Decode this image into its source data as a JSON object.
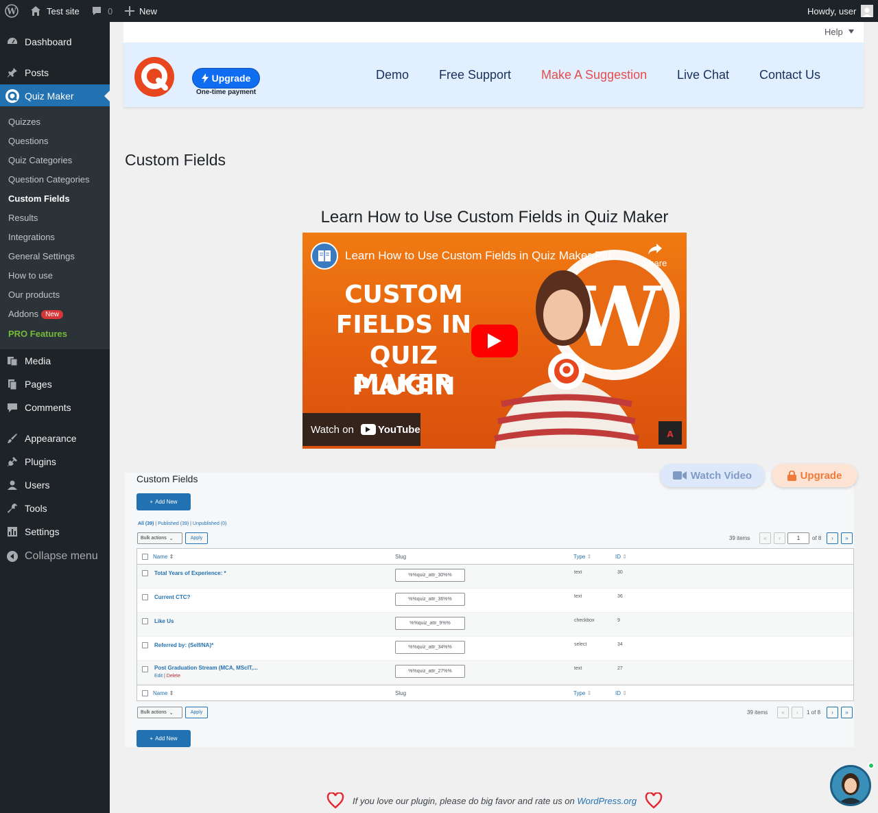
{
  "adminbar": {
    "site_name": "Test site",
    "comments_count": "0",
    "new_label": "New",
    "howdy": "Howdy, user"
  },
  "sidebar": {
    "items": [
      {
        "label": "Dashboard",
        "icon": "dashboard-icon"
      },
      {
        "label": "Posts",
        "icon": "pin-icon"
      },
      {
        "label": "Quiz Maker",
        "icon": "quiz-maker-icon"
      },
      {
        "label": "Media",
        "icon": "media-icon"
      },
      {
        "label": "Pages",
        "icon": "pages-icon"
      },
      {
        "label": "Comments",
        "icon": "comment-icon"
      },
      {
        "label": "Appearance",
        "icon": "brush-icon"
      },
      {
        "label": "Plugins",
        "icon": "plug-icon"
      },
      {
        "label": "Users",
        "icon": "user-icon"
      },
      {
        "label": "Tools",
        "icon": "wrench-icon"
      },
      {
        "label": "Settings",
        "icon": "settings-icon"
      },
      {
        "label": "Collapse menu",
        "icon": "collapse-icon"
      }
    ],
    "submenu": [
      "Quizzes",
      "Questions",
      "Quiz Categories",
      "Question Categories",
      "Custom Fields",
      "Results",
      "Integrations",
      "General Settings",
      "How to use",
      "Our products",
      "Addons",
      "PRO Features"
    ],
    "addons_badge": "New"
  },
  "help_tab": "Help",
  "header": {
    "upgrade_label": "Upgrade",
    "upgrade_note": "One-time payment",
    "nav": [
      "Demo",
      "Free Support",
      "Make A Suggestion",
      "Live Chat",
      "Contact Us"
    ]
  },
  "page_title": "Custom Fields",
  "video": {
    "heading": "Learn How to Use Custom Fields in Quiz Maker",
    "title": "Learn How to Use Custom Fields in Quiz Maker Plu...",
    "share": "Share",
    "big_lines": [
      "CUSTOM",
      "FIELDS IN",
      "QUIZ MAKER",
      "PLUGIN"
    ],
    "watch_on": "Watch on",
    "youtube": "YouTube"
  },
  "actions": {
    "watch_video": "Watch Video",
    "upgrade": "Upgrade"
  },
  "cf_screenshot": {
    "title": "Custom Fields",
    "add_new": "Add New",
    "filters": {
      "all": "All (39)",
      "published": "Published (39)",
      "unpublished": "Unpublished (0)"
    },
    "bulk_actions": "Bulk actions",
    "apply": "Apply",
    "items_count": "39 items",
    "page_current": "1",
    "page_of": "of 8",
    "page_text_bottom": "1 of 8",
    "columns": {
      "name": "Name",
      "slug": "Slug",
      "type": "Type",
      "id": "ID"
    },
    "rows": [
      {
        "name": "Total Years of Experience: *",
        "slug": "%%quiz_attr_30%%",
        "type": "text",
        "id": "30"
      },
      {
        "name": "Current CTC?",
        "slug": "%%quiz_attr_36%%",
        "type": "text",
        "id": "36"
      },
      {
        "name": "Like Us",
        "slug": "%%quiz_attr_9%%",
        "type": "checkbox",
        "id": "9"
      },
      {
        "name": "Referred by: (Self/NA)*",
        "slug": "%%quiz_attr_34%%",
        "type": "select",
        "id": "34"
      },
      {
        "name": "Post Graduation Stream (MCA, MScIT,...",
        "slug": "%%quiz_attr_27%%",
        "type": "text",
        "id": "27"
      }
    ],
    "row_actions": {
      "edit": "Edit",
      "delete": "Delete"
    }
  },
  "footer": {
    "text": "If you love our plugin, please do big favor and rate us on",
    "link": "WordPress.org"
  },
  "colors": {
    "admin_dark": "#1d2327",
    "wp_blue": "#2271b1",
    "header_bg": "#e1efff",
    "accent_red": "#e54c4c",
    "upgrade_blue": "#0f6df2"
  }
}
